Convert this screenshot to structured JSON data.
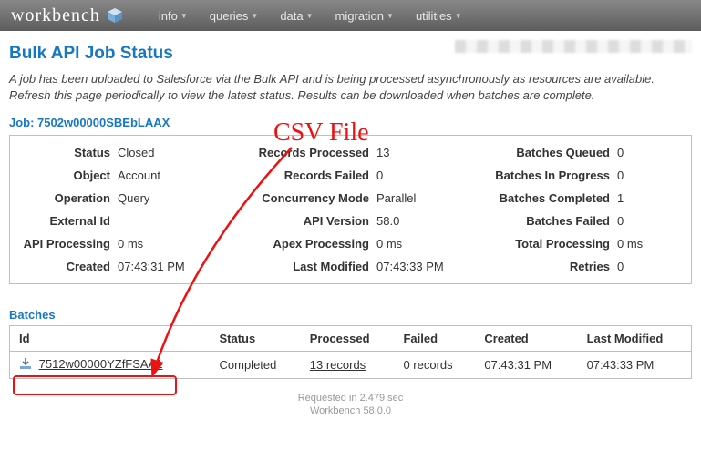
{
  "brand": "workbench",
  "nav": [
    "info",
    "queries",
    "data",
    "migration",
    "utilities"
  ],
  "page_title": "Bulk API Job Status",
  "intro": "A job has been uploaded to Salesforce via the Bulk API and is being processed asynchronously as resources are available. Refresh this page periodically to view the latest status. Results can be downloaded when batches are complete.",
  "job_header": "Job: 7502w00000SBEbLAAX",
  "job": {
    "col1": [
      {
        "k": "Status",
        "v": "Closed"
      },
      {
        "k": "Object",
        "v": "Account"
      },
      {
        "k": "Operation",
        "v": "Query"
      },
      {
        "k": "External Id",
        "v": ""
      },
      {
        "k": "API Processing",
        "v": "0 ms"
      },
      {
        "k": "Created",
        "v": "07:43:31 PM"
      }
    ],
    "col2": [
      {
        "k": "Records Processed",
        "v": "13"
      },
      {
        "k": "Records Failed",
        "v": "0"
      },
      {
        "k": "Concurrency Mode",
        "v": "Parallel"
      },
      {
        "k": "API Version",
        "v": "58.0"
      },
      {
        "k": "Apex Processing",
        "v": "0 ms"
      },
      {
        "k": "Last Modified",
        "v": "07:43:33 PM"
      }
    ],
    "col3": [
      {
        "k": "Batches Queued",
        "v": "0"
      },
      {
        "k": "Batches In Progress",
        "v": "0"
      },
      {
        "k": "Batches Completed",
        "v": "1"
      },
      {
        "k": "Batches Failed",
        "v": "0"
      },
      {
        "k": "Total Processing",
        "v": "0 ms"
      },
      {
        "k": "Retries",
        "v": "0"
      }
    ]
  },
  "batches_title": "Batches",
  "batches_headers": [
    "Id",
    "Status",
    "Processed",
    "Failed",
    "Created",
    "Last Modified"
  ],
  "batches_row": {
    "id": "7512w00000YZfFSAA1",
    "status": "Completed",
    "processed": "13 records",
    "failed": "0 records",
    "created": "07:43:31 PM",
    "modified": "07:43:33 PM"
  },
  "annotation": "CSV File",
  "footer": {
    "line1": "Requested in 2.479 sec",
    "line2": "Workbench 58.0.0"
  }
}
